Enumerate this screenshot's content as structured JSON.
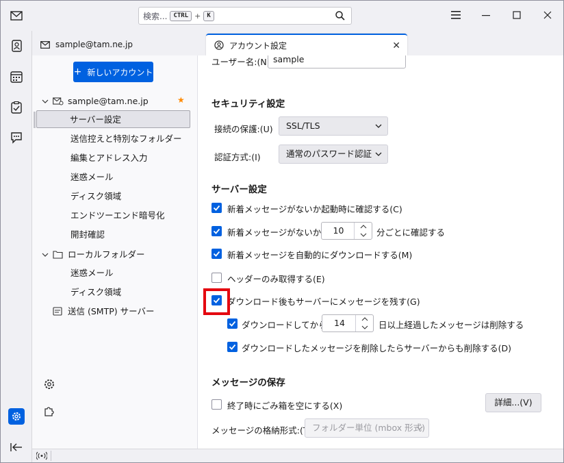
{
  "search": {
    "placeholder": "検索...",
    "key1": "CTRL",
    "plus": "+",
    "key2": "K"
  },
  "tabs": [
    {
      "label": "sample@tam.ne.jp"
    },
    {
      "label": "アカウント設定",
      "close": "✕"
    }
  ],
  "tree": {
    "new_account_label": "新しいアカウント",
    "new_account_plus": "+",
    "account": "sample@tam.ne.jp",
    "account_items": [
      "サーバー設定",
      "送信控えと特別なフォルダー",
      "編集とアドレス入力",
      "迷惑メール",
      "ディスク領域",
      "エンドツーエンド暗号化",
      "開封確認"
    ],
    "local": "ローカルフォルダー",
    "local_items": [
      "迷惑メール",
      "ディスク領域"
    ],
    "smtp": "送信 (SMTP) サーバー"
  },
  "settings": {
    "username_label": "ユーザー名:(N)",
    "username_value": "sample",
    "security_heading": "セキュリティ設定",
    "connection_label": "接続の保護:(U)",
    "connection_value": "SSL/TLS",
    "auth_label": "認証方式:(I)",
    "auth_value": "通常のパスワード認証",
    "server_heading": "サーバー設定",
    "check_startup": "新着メッセージがないか起動時に確認する(C)",
    "check_every": "新着メッセージがないか(Y)",
    "check_every_value": "10",
    "check_every_suffix": "分ごとに確認する",
    "auto_download": "新着メッセージを自動的にダウンロードする(M)",
    "headers_only": "ヘッダーのみ取得する(E)",
    "leave_on_server": "ダウンロード後もサーバーにメッセージを残す(G)",
    "after_download": "ダウンロードしてから(O)",
    "after_download_value": "14",
    "after_download_suffix": "日以上経過したメッセージは削除する",
    "delete_from_server": "ダウンロードしたメッセージを削除したらサーバーからも削除する(D)",
    "storage_heading": "メッセージの保存",
    "empty_trash": "終了時にごみ箱を空にする(X)",
    "details_button": "詳細...(V)",
    "store_type_label": "メッセージの格納形式:(T)",
    "store_type_value": "フォルダー単位 (mbox 形式)"
  },
  "checkbox_states": {
    "check_startup": true,
    "check_every": true,
    "auto_download": true,
    "headers_only": false,
    "leave_on_server": true,
    "after_download": true,
    "delete_from_server": true,
    "empty_trash": false
  },
  "colors": {
    "accent": "#0061e0",
    "highlight": "#e4060f",
    "star": "#ff8a00"
  },
  "icons": [
    "mail-icon",
    "address-book-icon",
    "calendar-icon",
    "tasks-icon",
    "chat-icon",
    "settings-icon",
    "collapse-icon",
    "search-icon",
    "account-settings-icon",
    "add-ons-icon",
    "status-icon"
  ]
}
